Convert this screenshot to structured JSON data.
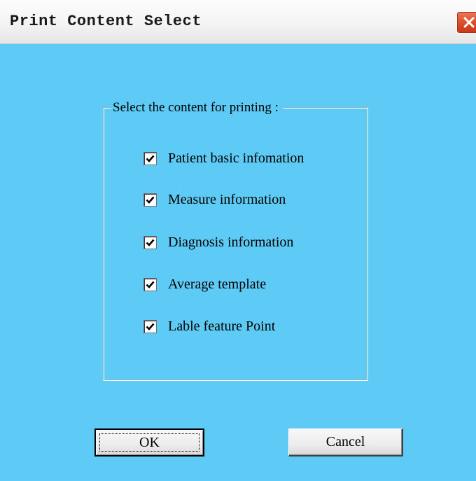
{
  "window": {
    "title": "Print Content Select",
    "close_icon": "close-icon"
  },
  "group": {
    "label": "Select the content for printing :",
    "items": [
      {
        "label": "Patient basic infomation",
        "checked": true
      },
      {
        "label": "Measure information",
        "checked": true
      },
      {
        "label": "Diagnosis information",
        "checked": true
      },
      {
        "label": "Average template",
        "checked": true
      },
      {
        "label": "Lable feature Point",
        "checked": true
      }
    ]
  },
  "buttons": {
    "ok_label": "OK",
    "cancel_label": "Cancel"
  },
  "colors": {
    "background": "#5ecbf6",
    "close_button": "#d94b2a"
  }
}
